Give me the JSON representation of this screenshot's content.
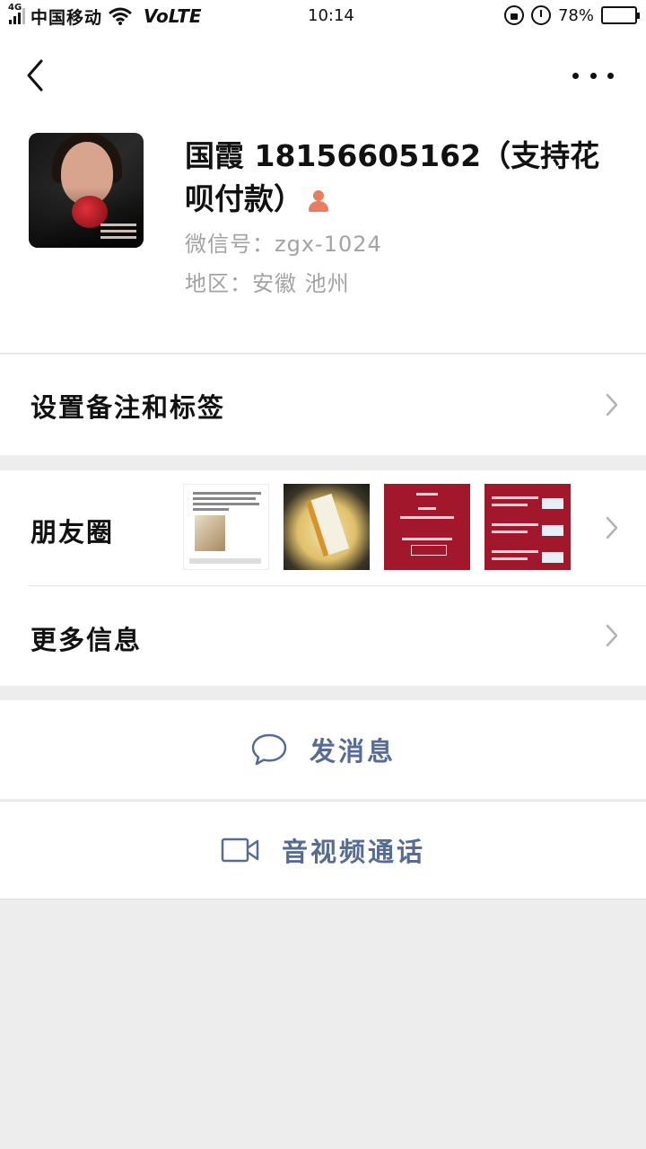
{
  "status_bar": {
    "network": "4G",
    "carrier": "中国移动",
    "volte": "VoLTE",
    "time": "10:14",
    "battery_percent": "78%",
    "battery_level": 0.78
  },
  "header": {
    "back_icon": "chevron-left-icon",
    "more_icon": "more-horizontal-icon"
  },
  "profile": {
    "name": "国霞 18156605162（支持花呗付款）",
    "gender_icon": "female-person-icon",
    "gender_color": "#e87d62",
    "wechat_id": "微信号：zgx-1024",
    "region": "地区：安徽 池州"
  },
  "rows": {
    "remark_label": "设置备注和标签",
    "moments_label": "朋友圈",
    "more_info_label": "更多信息"
  },
  "moments_thumbnails": [
    "text-post-thumbnail",
    "food-photo-thumbnail",
    "promo-poster-thumbnail",
    "promo-list-thumbnail"
  ],
  "actions": {
    "message_label": "发消息",
    "message_icon": "chat-bubble-icon",
    "call_label": "音视频通话",
    "call_icon": "video-camera-icon",
    "accent_color": "#576b95"
  }
}
